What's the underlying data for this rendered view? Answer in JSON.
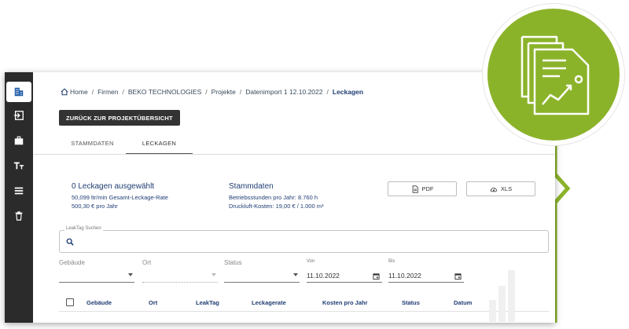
{
  "breadcrumb": {
    "home": "Home",
    "items": [
      "Firmen",
      "BEKO TECHNOLOGIES",
      "Projekte",
      "Datenimport 1 12.10.2022"
    ],
    "current": "Leckagen"
  },
  "back_button": "ZURÜCK ZUR PROJEKTÜBERSICHT",
  "tabs": [
    {
      "label": "STAMMDATEN",
      "active": false
    },
    {
      "label": "LECKAGEN",
      "active": true
    }
  ],
  "summary": {
    "title": "0 Leckagen ausgewählt",
    "rate": "50,099 ltr/min Gesamt-Leckage-Rate",
    "cost": "500,30 € pro Jahr"
  },
  "stammdaten": {
    "title": "Stammdaten",
    "hours": "Betriebsstunden pro Jahr: 8.760 h",
    "air_cost": "Druckluft-Kosten: 19,00 € / 1.000 m³"
  },
  "export": {
    "pdf": "PDF",
    "xls": "XLS"
  },
  "search": {
    "legend": "LeakTag Suchen",
    "value": ""
  },
  "filters": {
    "gebaeude": "Gebäude",
    "ort": "Ort",
    "status": "Status",
    "von_label": "Von",
    "von_value": "11.10.2022",
    "bis_label": "Bis",
    "bis_value": "11.10.2022"
  },
  "table": {
    "columns": [
      "Gebäude",
      "Ort",
      "LeakTag",
      "Leckagerate",
      "Kosten pro Jahr",
      "Status",
      "Datum"
    ]
  },
  "colors": {
    "accent_green": "#8bb32a",
    "sidebar": "#2b2b2b",
    "text_blue": "#1f3d73",
    "button_dark": "#333333"
  },
  "icons": {
    "sidebar": [
      "company-icon",
      "import-icon",
      "briefcase-icon",
      "text-format-icon",
      "list-icon",
      "trash-icon"
    ],
    "badge": "report-document-icon"
  }
}
